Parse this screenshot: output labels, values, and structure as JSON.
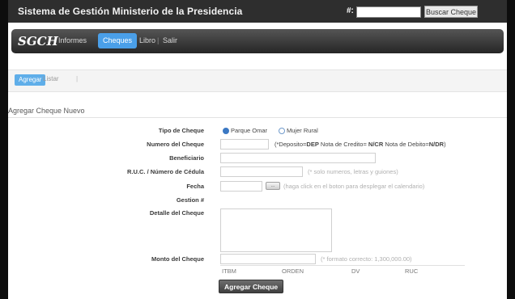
{
  "app": {
    "title": "Sistema de Gestión Ministerio de la Presidencia",
    "search_label": "#:",
    "search_value": "",
    "search_button_label": "Buscar Cheque"
  },
  "nav": {
    "brand": "SGCH",
    "items": [
      {
        "label": "Informes",
        "active": false
      },
      {
        "label": "Cheques",
        "active": true
      },
      {
        "label": "Libro",
        "active": false
      },
      {
        "label": "Salir",
        "active": false
      }
    ],
    "separator": "|"
  },
  "subtabs": {
    "add_label": "Agregar",
    "list_label": "Listar",
    "separator": "|"
  },
  "form": {
    "section_title": "Agregar Cheque Nuevo",
    "tipo_label": "Tipo de Cheque",
    "tipo_options": [
      "Parque Omar",
      "Mujer Rural"
    ],
    "tipo_selected": "Parque Omar",
    "numero_label": "Numero del Cheque",
    "numero_hint_pre": "(*Deposito=",
    "numero_hint_dep": "DEP",
    "numero_hint_mid": " Nota de Credito= ",
    "numero_hint_ncr": "N/CR",
    "numero_hint_mid2": " Nota de Debito=",
    "numero_hint_ndr": "N/DR",
    "numero_hint_post": ")",
    "beneficiario_label": "Beneficiario",
    "ruc_label": "R.U.C. / Número de Cédula",
    "ruc_hint": "(* solo numeros, letras y guiones)",
    "fecha_label": "Fecha",
    "fecha_button_label": "...",
    "fecha_hint": "(haga click en el boton para desplegar el calendario)",
    "gestion_label": "Gestion #",
    "detalle_label": "Detalle del Cheque",
    "monto_label": "Monto del Cheque",
    "monto_hint": "(* formato correcto: 1,300,000.00)",
    "columns": [
      "ITBM",
      "ORDEN",
      "DV",
      "RUC"
    ],
    "submit_label": "Agregar Cheque"
  },
  "colors": {
    "accent": "#4a9fe8",
    "navbar": "#262626",
    "topbar": "#2e2e2e"
  }
}
